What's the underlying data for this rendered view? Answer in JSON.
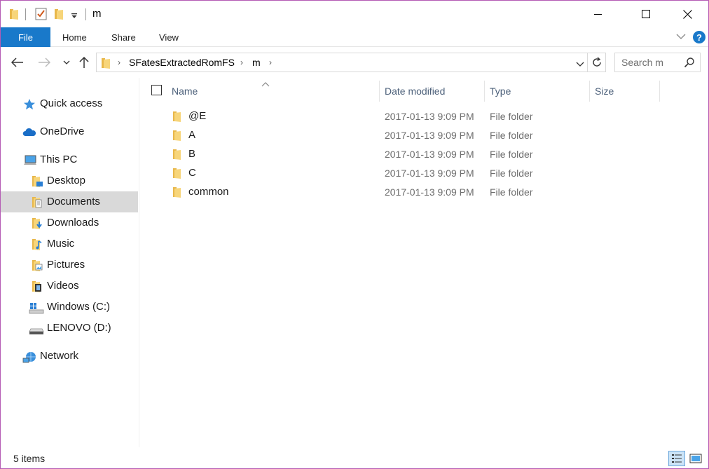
{
  "window": {
    "title": "m",
    "minimize_icon": "minimize-icon",
    "maximize_icon": "maximize-icon",
    "close_icon": "close-icon"
  },
  "ribbon": {
    "tabs": [
      {
        "label": "File"
      },
      {
        "label": "Home"
      },
      {
        "label": "Share"
      },
      {
        "label": "View"
      }
    ],
    "accent": "#1979ca"
  },
  "address": {
    "crumbs": [
      {
        "label": "SFatesExtractedRomFS"
      },
      {
        "label": "m"
      }
    ]
  },
  "search": {
    "placeholder": "Search m"
  },
  "nav": {
    "items": [
      {
        "label": "Quick access",
        "icon": "star-icon"
      },
      {
        "label": "OneDrive",
        "icon": "cloud-icon"
      },
      {
        "label": "This PC",
        "icon": "computer-icon"
      },
      {
        "label": "Desktop",
        "icon": "desktop-folder-icon"
      },
      {
        "label": "Documents",
        "icon": "documents-folder-icon",
        "selected": true
      },
      {
        "label": "Downloads",
        "icon": "downloads-folder-icon"
      },
      {
        "label": "Music",
        "icon": "music-folder-icon"
      },
      {
        "label": "Pictures",
        "icon": "pictures-folder-icon"
      },
      {
        "label": "Videos",
        "icon": "videos-folder-icon"
      },
      {
        "label": "Windows (C:)",
        "icon": "windows-drive-icon"
      },
      {
        "label": "LENOVO (D:)",
        "icon": "drive-icon"
      },
      {
        "label": "Network",
        "icon": "network-icon"
      }
    ]
  },
  "columns": {
    "name": "Name",
    "date": "Date modified",
    "type": "Type",
    "size": "Size"
  },
  "files": [
    {
      "name": "@E",
      "date": "2017-01-13 9:09 PM",
      "type": "File folder"
    },
    {
      "name": "A",
      "date": "2017-01-13 9:09 PM",
      "type": "File folder"
    },
    {
      "name": "B",
      "date": "2017-01-13 9:09 PM",
      "type": "File folder"
    },
    {
      "name": "C",
      "date": "2017-01-13 9:09 PM",
      "type": "File folder"
    },
    {
      "name": "common",
      "date": "2017-01-13 9:09 PM",
      "type": "File folder"
    }
  ],
  "status": {
    "item_count": "5 items"
  }
}
